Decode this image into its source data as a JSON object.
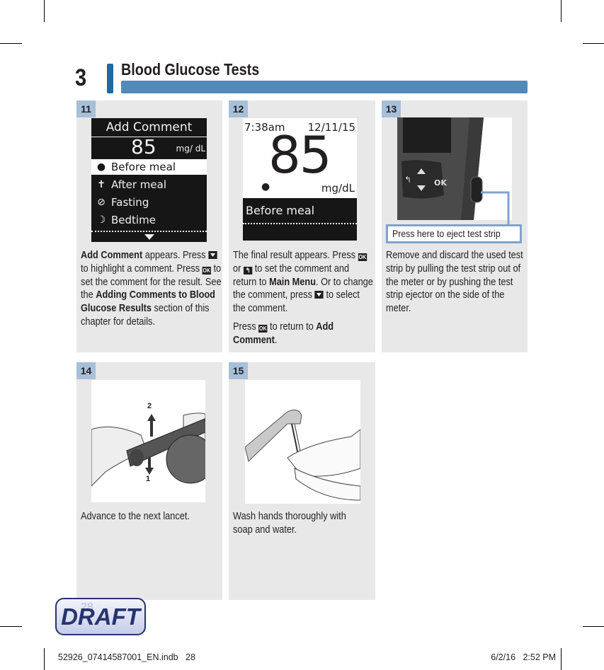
{
  "header": {
    "chapter_number": "3",
    "chapter_title": "Blood Glucose Tests"
  },
  "colors": {
    "accent_dark": "#1f6aa5",
    "accent_bar": "#5289bb",
    "badge": "#a7bfd9",
    "panel_bg": "#e8e8e8",
    "callout_border": "#7fa3cc",
    "draft_ink": "#27336e"
  },
  "steps": [
    {
      "number": "11",
      "screen": {
        "title": "Add Comment",
        "value": "85",
        "unit": "mg/ dL",
        "options": [
          {
            "icon": "apple-icon",
            "label": "Before meal",
            "selected": true
          },
          {
            "icon": "apple-core-icon",
            "label": "After meal",
            "selected": false
          },
          {
            "icon": "no-symbol-icon",
            "label": "Fasting",
            "selected": false
          },
          {
            "icon": "moon-icon",
            "label": "Bedtime",
            "selected": false
          }
        ],
        "scroll_indicator": "down-arrow-icon"
      },
      "caption": {
        "b1": "Add Comment",
        "t1": " appears. Press ",
        "t2": " to highlight a comment. Press ",
        "t3": " to set the comment for the result. See the ",
        "b2": "Adding Comments to Blood Glucose Results",
        "t4": " section of this chapter for details."
      }
    },
    {
      "number": "12",
      "screen": {
        "time": "7:38am",
        "date": "12/11/15",
        "value": "85",
        "unit": "mg/dL",
        "comment": "Before meal"
      },
      "caption": {
        "t1": "The final result appears. Press ",
        "t_or": " or ",
        "t2": " to set the comment and return to ",
        "b1": "Main Menu",
        "t3": ". Or to change the comment, press ",
        "t4": " to select the comment.",
        "p2_t1": "Press ",
        "p2_t2": " to return to ",
        "p2_b1": "Add Comment",
        "p2_t3": "."
      }
    },
    {
      "number": "13",
      "callout": "Press here to eject test strip",
      "caption": "Remove and discard the used test strip by pulling the test strip out of the meter or by pushing the test strip ejector on the side of the meter."
    },
    {
      "number": "14",
      "figure_labels": [
        "2",
        "1"
      ],
      "caption": "Advance to the next lancet."
    },
    {
      "number": "15",
      "caption": "Wash hands thoroughly with soap and water."
    }
  ],
  "keys": {
    "ok": "OK",
    "back": "↰"
  },
  "watermark": {
    "label": "DRAFT",
    "page_number": "28"
  },
  "slug": {
    "file": "52926_07414587001_EN.indb   28",
    "timestamp": "6/2/16   2:52 PM"
  }
}
